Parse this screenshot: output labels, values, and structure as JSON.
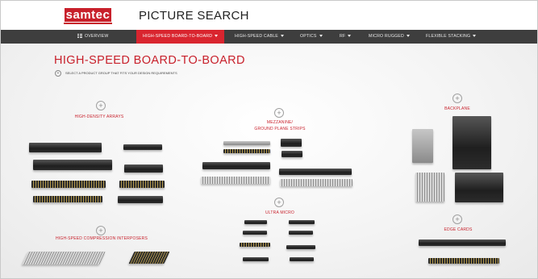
{
  "brand": {
    "logo_text": "samtec"
  },
  "header": {
    "title": "PICTURE SEARCH"
  },
  "nav": {
    "items": [
      {
        "label": "OVERVIEW",
        "has_grid_icon": true,
        "has_caret": false,
        "active": false
      },
      {
        "label": "HIGH-SPEED BOARD-TO-BOARD",
        "has_caret": true,
        "active": true
      },
      {
        "label": "HIGH-SPEED CABLE",
        "has_caret": true,
        "active": false
      },
      {
        "label": "OPTICS",
        "has_caret": true,
        "active": false
      },
      {
        "label": "RF",
        "has_caret": true,
        "active": false
      },
      {
        "label": "MICRO RUGGED",
        "has_caret": true,
        "active": false
      },
      {
        "label": "FLEXIBLE STACKING",
        "has_caret": true,
        "active": false
      }
    ]
  },
  "main": {
    "section_title": "HIGH-SPEED BOARD-TO-BOARD",
    "instruction": "SELECT A PRODUCT GROUP THAT FITS YOUR DESIGN REQUIREMENTS",
    "groups": [
      {
        "id": "high-density-arrays",
        "label": "HIGH-DENSITY ARRAYS"
      },
      {
        "id": "mezzanine",
        "label_line1": "MEZZANINE/",
        "label_line2": "GROUND PLANE STRIPS"
      },
      {
        "id": "backplane",
        "label": "BACKPLANE"
      },
      {
        "id": "ultra-micro",
        "label": "ULTRA MICRO"
      },
      {
        "id": "edge-cards",
        "label": "EDGE CARDS"
      },
      {
        "id": "compression-interposers",
        "label": "HIGH-SPEED COMPRESSION INTERPOSERS"
      }
    ]
  },
  "colors": {
    "accent": "#c8202b",
    "nav_bg": "#3e3e3e",
    "nav_active": "#d9252f"
  }
}
